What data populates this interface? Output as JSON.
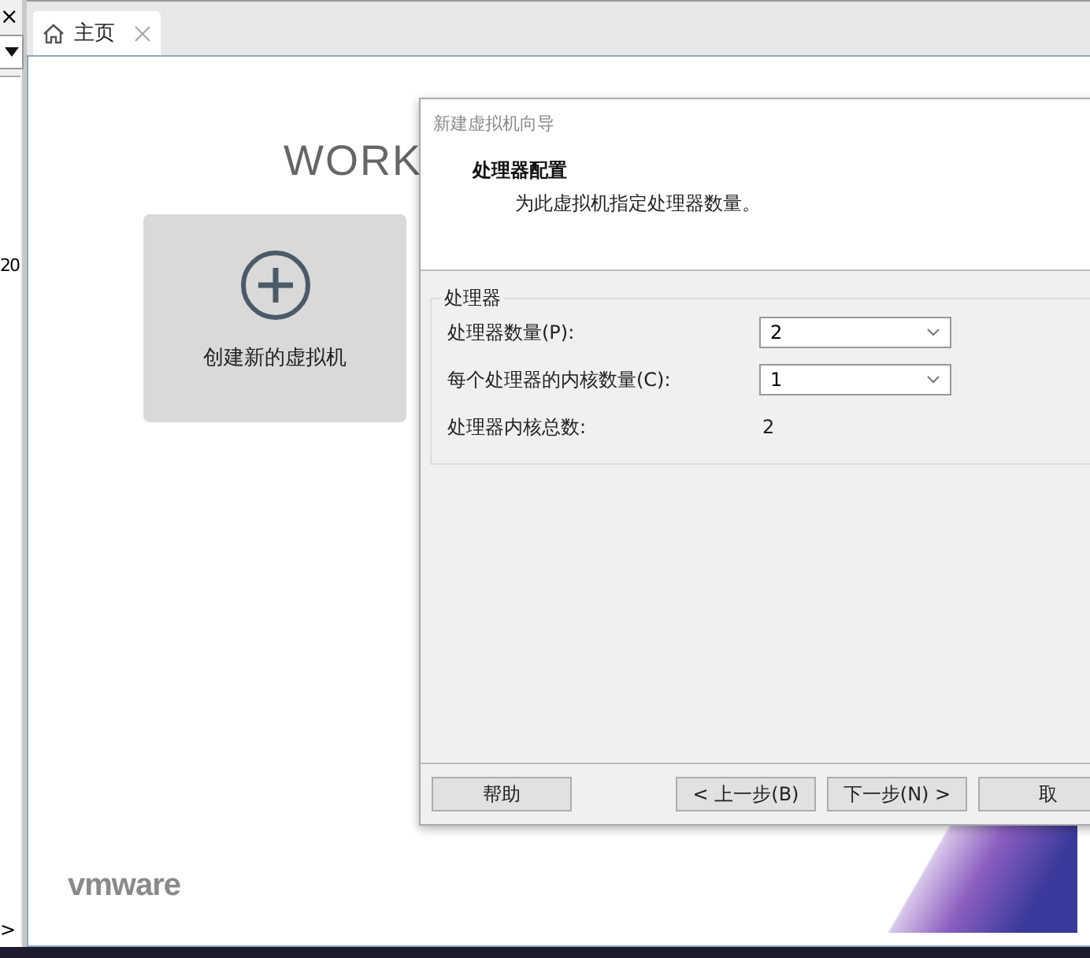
{
  "left_pane": {
    "close_glyph": "×",
    "value": "20",
    "scroll_glyph": ">"
  },
  "tabs": [
    {
      "label": "主页",
      "selected": true
    }
  ],
  "home": {
    "logo_text": "WORK",
    "create_card": {
      "label": "创建新的虚拟机"
    },
    "brand": "vmware"
  },
  "dialog": {
    "title": "新建虚拟机向导",
    "heading": "处理器配置",
    "subheading": "为此虚拟机指定处理器数量。",
    "group": {
      "label": "处理器",
      "fields": [
        {
          "kind": "select",
          "label": "处理器数量(P):",
          "value": "2"
        },
        {
          "kind": "select",
          "label": "每个处理器的内核数量(C):",
          "value": "1"
        },
        {
          "kind": "readout",
          "label": "处理器内核总数:",
          "value": "2"
        }
      ]
    },
    "left_buttons": [
      {
        "label": "帮助"
      }
    ],
    "right_buttons": [
      {
        "label": "< 上一步(B)"
      },
      {
        "label": "下一步(N) >"
      },
      {
        "label": "取"
      }
    ]
  }
}
